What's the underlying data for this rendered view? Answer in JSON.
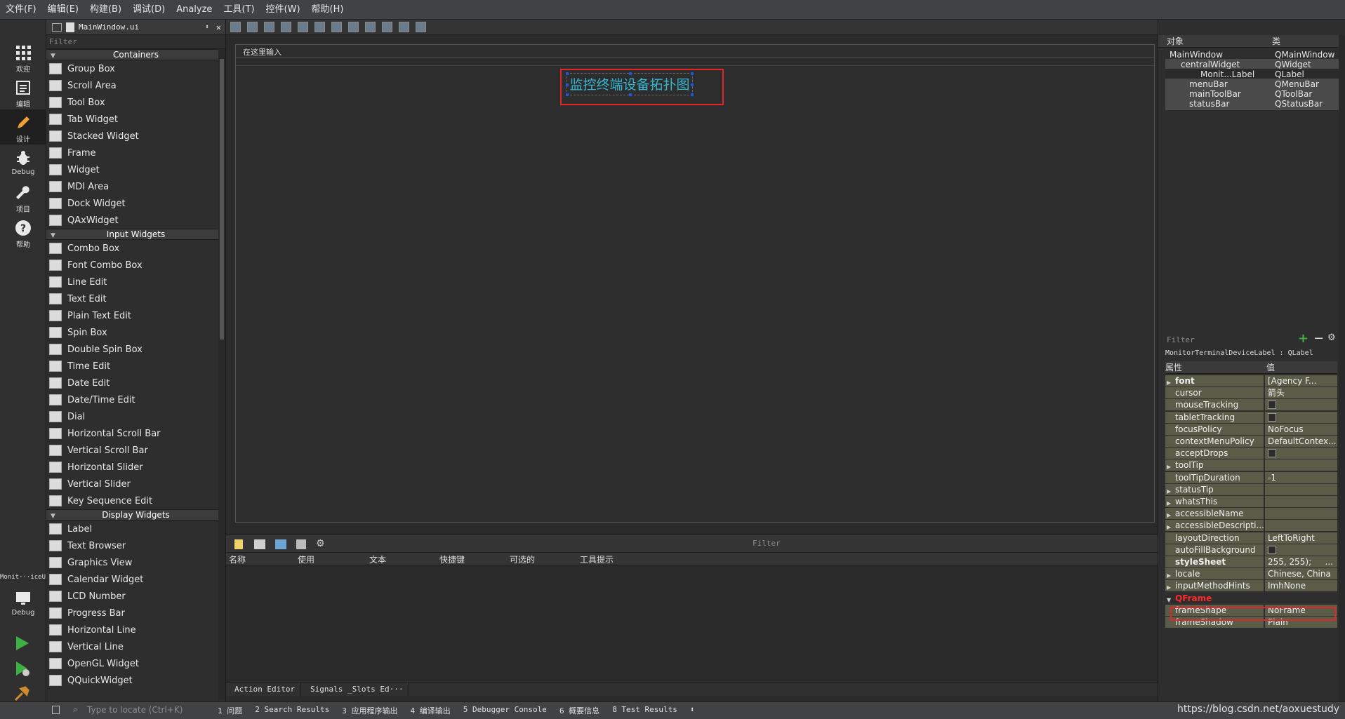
{
  "menubar": [
    "文件(F)",
    "编辑(E)",
    "构建(B)",
    "调试(D)",
    "Analyze",
    "工具(T)",
    "控件(W)",
    "帮助(H)"
  ],
  "modes": [
    "欢迎",
    "编辑",
    "设计",
    "Debug",
    "项目",
    "帮助"
  ],
  "kit": {
    "name": "Monit···iceUI",
    "mode": "Debug"
  },
  "widget_box": {
    "file": "MainWindow.ui",
    "filter": "Filter",
    "containers_title": "Containers",
    "containers": [
      "Group Box",
      "Scroll Area",
      "Tool Box",
      "Tab Widget",
      "Stacked Widget",
      "Frame",
      "Widget",
      "MDI Area",
      "Dock Widget",
      "QAxWidget"
    ],
    "input_title": "Input Widgets",
    "input": [
      "Combo Box",
      "Font Combo Box",
      "Line Edit",
      "Text Edit",
      "Plain Text Edit",
      "Spin Box",
      "Double Spin Box",
      "Time Edit",
      "Date Edit",
      "Date/Time Edit",
      "Dial",
      "Horizontal Scroll Bar",
      "Vertical Scroll Bar",
      "Horizontal Slider",
      "Vertical Slider",
      "Key Sequence Edit"
    ],
    "display_title": "Display Widgets",
    "display": [
      "Label",
      "Text Browser",
      "Graphics View",
      "Calendar Widget",
      "LCD Number",
      "Progress Bar",
      "Horizontal Line",
      "Vertical Line",
      "OpenGL Widget",
      "QQuickWidget"
    ]
  },
  "form": {
    "menu_placeholder": "在这里输入",
    "title_label": "监控终端设备拓扑图"
  },
  "action_editor": {
    "filter": "Filter",
    "columns": [
      "名称",
      "使用",
      "文本",
      "快捷键",
      "可选的",
      "工具提示"
    ],
    "tabs": [
      "Action Editor",
      "Signals _Slots Ed···"
    ]
  },
  "object_inspector": {
    "headers": [
      "对象",
      "类"
    ],
    "rows": [
      {
        "name": "MainWindow",
        "cls": "QMainWindow"
      },
      {
        "name": "centralWidget",
        "cls": "QWidget"
      },
      {
        "name": "Monit...Label",
        "cls": "QLabel"
      },
      {
        "name": "menuBar",
        "cls": "QMenuBar"
      },
      {
        "name": "mainToolBar",
        "cls": "QToolBar"
      },
      {
        "name": "statusBar",
        "cls": "QStatusBar"
      }
    ]
  },
  "property_editor": {
    "filter": "Filter",
    "object_label": "MonitorTerminalDeviceLabel : QLabel",
    "headers": [
      "属性",
      "值"
    ],
    "rows": [
      {
        "name": "font",
        "value": "[Agency F..."
      },
      {
        "name": "cursor",
        "value": "箭头"
      },
      {
        "name": "mouseTracking",
        "value": ""
      },
      {
        "name": "tabletTracking",
        "value": ""
      },
      {
        "name": "focusPolicy",
        "value": "NoFocus"
      },
      {
        "name": "contextMenuPolicy",
        "value": "DefaultContex..."
      },
      {
        "name": "acceptDrops",
        "value": ""
      },
      {
        "name": "toolTip",
        "value": ""
      },
      {
        "name": "toolTipDuration",
        "value": "-1"
      },
      {
        "name": "statusTip",
        "value": ""
      },
      {
        "name": "whatsThis",
        "value": ""
      },
      {
        "name": "accessibleName",
        "value": ""
      },
      {
        "name": "accessibleDescripti...",
        "value": ""
      },
      {
        "name": "layoutDirection",
        "value": "LeftToRight"
      },
      {
        "name": "autoFillBackground",
        "value": ""
      },
      {
        "name": "styleSheet",
        "value": "255, 255);"
      },
      {
        "name": "locale",
        "value": "Chinese, China"
      },
      {
        "name": "inputMethodHints",
        "value": "ImhNone"
      },
      {
        "name": "QFrame",
        "value": ""
      },
      {
        "name": "frameShape",
        "value": "NoFrame"
      },
      {
        "name": "frameShadow",
        "value": "Plain"
      }
    ],
    "stylesheet_button": "..."
  },
  "status_bar": {
    "locate_placeholder": "Type to locate (Ctrl+K)",
    "panes": [
      "1 问题",
      "2 Search Results",
      "3 应用程序输出",
      "4 编译输出",
      "5 Debugger Console",
      "6 概要信息",
      "8 Test Results"
    ],
    "watermark": "https://blog.csdn.net/aoxuestudy"
  }
}
